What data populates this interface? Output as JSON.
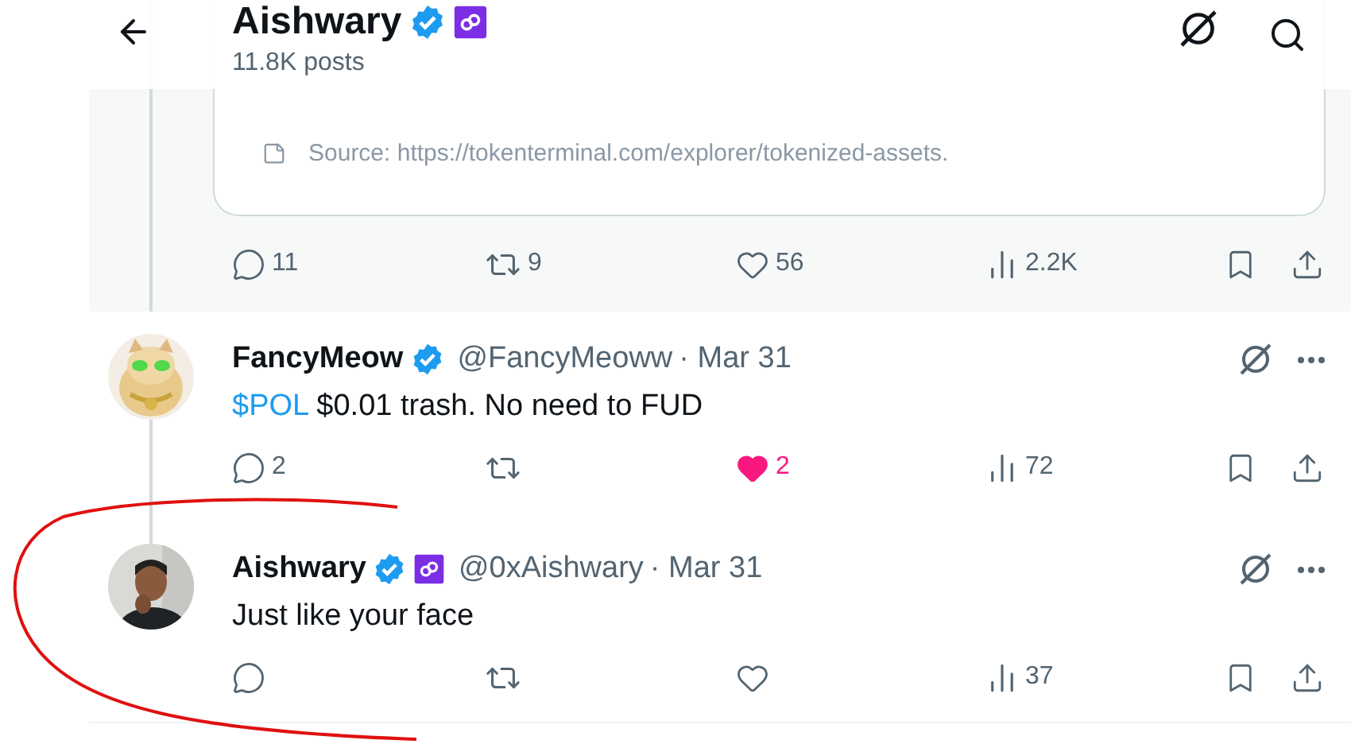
{
  "header": {
    "name": "Aishwary",
    "verified": true,
    "affiliate": true,
    "posts": "11.8K posts"
  },
  "quoted_card": {
    "source": "Source: https://tokenterminal.com/explorer/tokenized-assets."
  },
  "main_actions": {
    "reply": "11",
    "repost": "9",
    "like": "56",
    "liked": false,
    "views": "2.2K"
  },
  "replies": [
    {
      "name": "FancyMeow",
      "verified": true,
      "affiliate": false,
      "handle": "@FancyMeoww",
      "date": "· Mar 31",
      "cashtag": "$POL",
      "text": "$0.01 trash. No need to FUD",
      "reply": "2",
      "like": "2",
      "liked": true,
      "views": "72"
    },
    {
      "name": "Aishwary",
      "verified": true,
      "affiliate": true,
      "handle": "@0xAishwary",
      "date": "· Mar 31",
      "text": "Just like your face",
      "liked": false,
      "views": "37"
    }
  ]
}
